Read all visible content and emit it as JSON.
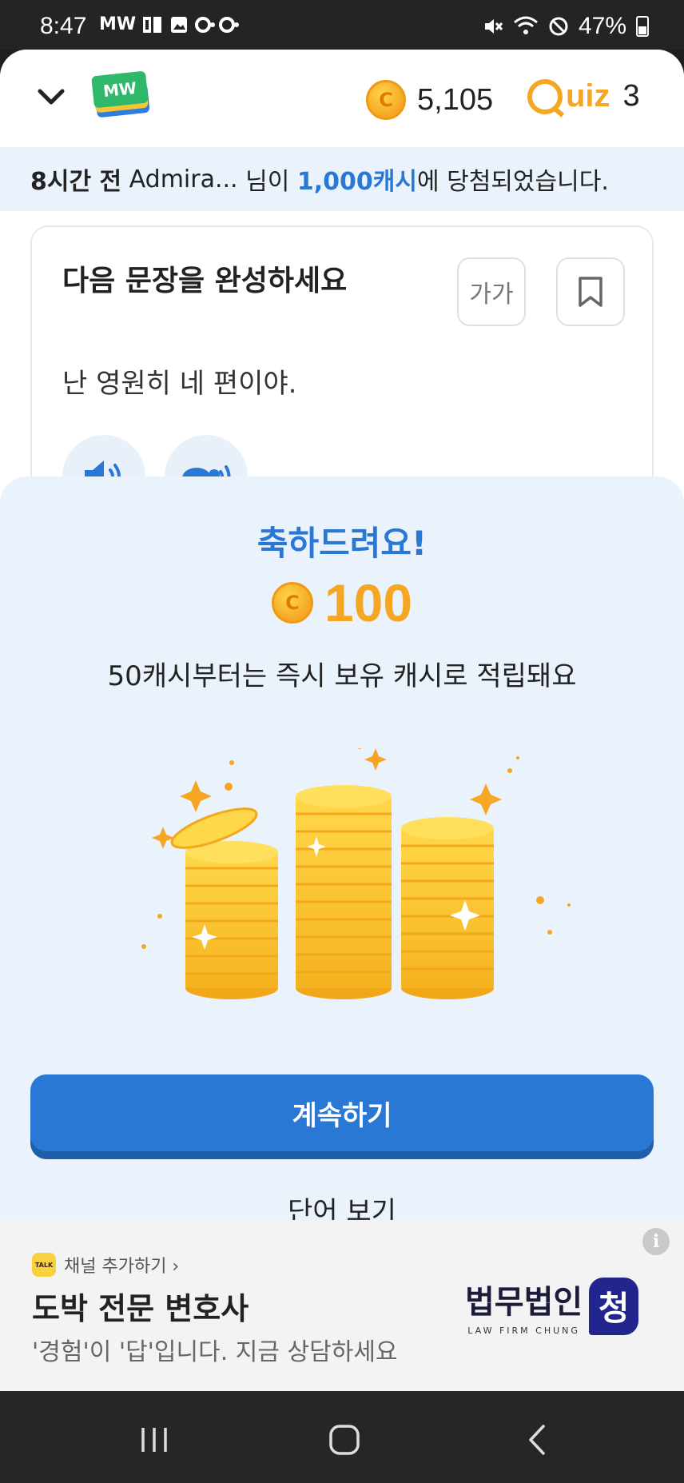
{
  "status_bar": {
    "time": "8:47",
    "left_icons_text": "MW",
    "battery": "47%"
  },
  "header": {
    "logo_text": "MW",
    "coin_symbol": "C",
    "balance": "5,105",
    "quiz_label": "uiz",
    "quiz_count": "3"
  },
  "ticker": {
    "time_ago": "8시간 전",
    "user": "Admira...",
    "mid": " 님이 ",
    "prize": "1,000캐시",
    "tail": "에 당첨되었습니다."
  },
  "question": {
    "title": "다음 문장을 완성하세요",
    "font_button": "가가",
    "sentence": "난 영원히 네 편이야."
  },
  "reward_sheet": {
    "congrats": "축하드려요!",
    "amount": "100",
    "description": "50캐시부터는 즉시 보유 캐시로 적립돼요",
    "continue_label": "계속하기",
    "view_words_label": "단어 보기"
  },
  "ad": {
    "channel_badge": "TALK",
    "channel_label": "채널 추가하기 ›",
    "headline": "도박 전문 변호사",
    "subline": "'경험'이 '답'입니다. 지금 상담하세요",
    "brand_ko": "법무법인",
    "brand_en": "LAW FIRM CHUNG",
    "brand_badge": "청",
    "info_icon": "i"
  },
  "colors": {
    "accent_blue": "#2a78d6",
    "coin_orange": "#f5a623",
    "sheet_bg": "#eaf2fc"
  }
}
